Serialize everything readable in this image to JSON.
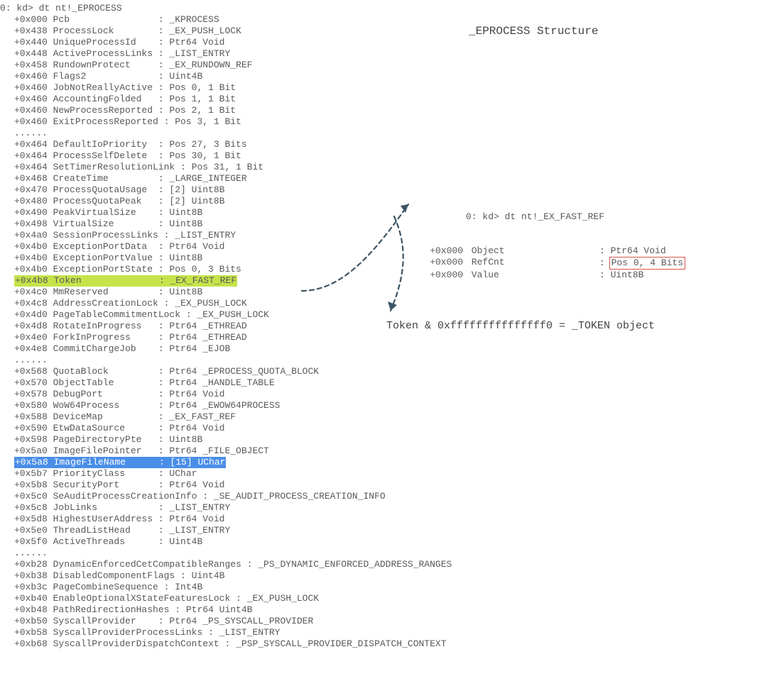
{
  "colors": {
    "highlight_green": "#c6e34a",
    "highlight_blue": "#4a8ee8",
    "box_red": "#d9544d"
  },
  "title": "_EPROCESS Structure",
  "main_prompt": "0: kd> dt nt!_EPROCESS",
  "lines": [
    {
      "offset": "+0x000",
      "name": "Pcb",
      "pad": "                ",
      "type": "_KPROCESS"
    },
    {
      "offset": "+0x438",
      "name": "ProcessLock",
      "pad": "        ",
      "type": "_EX_PUSH_LOCK"
    },
    {
      "offset": "+0x440",
      "name": "UniqueProcessId",
      "pad": "    ",
      "type": "Ptr64 Void"
    },
    {
      "offset": "+0x448",
      "name": "ActiveProcessLinks",
      "pad": " ",
      "type": "_LIST_ENTRY"
    },
    {
      "offset": "+0x458",
      "name": "RundownProtect",
      "pad": "     ",
      "type": "_EX_RUNDOWN_REF"
    },
    {
      "offset": "+0x460",
      "name": "Flags2",
      "pad": "             ",
      "type": "Uint4B"
    },
    {
      "offset": "+0x460",
      "name": "JobNotReallyActive",
      "pad": " ",
      "type": "Pos 0, 1 Bit"
    },
    {
      "offset": "+0x460",
      "name": "AccountingFolded",
      "pad": "   ",
      "type": "Pos 1, 1 Bit"
    },
    {
      "offset": "+0x460",
      "name": "NewProcessReported",
      "pad": " ",
      "type": "Pos 2, 1 Bit"
    },
    {
      "offset": "+0x460",
      "name": "ExitProcessReported",
      "pad": "",
      "type": "Pos 3, 1 Bit"
    },
    {
      "text": "......"
    },
    {
      "offset": "+0x464",
      "name": "DefaultIoPriority",
      "pad": "  ",
      "type": "Pos 27, 3 Bits"
    },
    {
      "offset": "+0x464",
      "name": "ProcessSelfDelete",
      "pad": "  ",
      "type": "Pos 30, 1 Bit"
    },
    {
      "offset": "+0x464",
      "name": "SetTimerResolutionLink",
      "pad": " ",
      "type": "Pos 31, 1 Bit",
      "nocolon": true
    },
    {
      "offset": "+0x468",
      "name": "CreateTime",
      "pad": "         ",
      "type": "_LARGE_INTEGER"
    },
    {
      "offset": "+0x470",
      "name": "ProcessQuotaUsage",
      "pad": "  ",
      "type": "[2] Uint8B"
    },
    {
      "offset": "+0x480",
      "name": "ProcessQuotaPeak",
      "pad": "   ",
      "type": "[2] Uint8B"
    },
    {
      "offset": "+0x490",
      "name": "PeakVirtualSize",
      "pad": "    ",
      "type": "Uint8B"
    },
    {
      "offset": "+0x498",
      "name": "VirtualSize",
      "pad": "        ",
      "type": "Uint8B"
    },
    {
      "offset": "+0x4a0",
      "name": "SessionProcessLinks",
      "pad": "",
      "type": "_LIST_ENTRY"
    },
    {
      "offset": "+0x4b0",
      "name": "ExceptionPortData",
      "pad": "  ",
      "type": "Ptr64 Void"
    },
    {
      "offset": "+0x4b0",
      "name": "ExceptionPortValue",
      "pad": " ",
      "type": "Uint8B"
    },
    {
      "offset": "+0x4b0",
      "name": "ExceptionPortState",
      "pad": " ",
      "type": "Pos 0, 3 Bits"
    },
    {
      "offset": "+0x4b8",
      "name": "Token",
      "pad": "              ",
      "type": "_EX_FAST_REF",
      "hl": "green"
    },
    {
      "offset": "+0x4c0",
      "name": "MmReserved",
      "pad": "         ",
      "type": "Uint8B"
    },
    {
      "offset": "+0x4c8",
      "name": "AddressCreationLock",
      "pad": "",
      "type": "_EX_PUSH_LOCK"
    },
    {
      "offset": "+0x4d0",
      "name": "PageTableCommitmentLock",
      "pad": " ",
      "type": "_EX_PUSH_LOCK",
      "nocolon": true
    },
    {
      "offset": "+0x4d8",
      "name": "RotateInProgress",
      "pad": "   ",
      "type": "Ptr64 _ETHREAD"
    },
    {
      "offset": "+0x4e0",
      "name": "ForkInProgress",
      "pad": "     ",
      "type": "Ptr64 _ETHREAD"
    },
    {
      "offset": "+0x4e8",
      "name": "CommitChargeJob",
      "pad": "    ",
      "type": "Ptr64 _EJOB"
    },
    {
      "text": "......"
    },
    {
      "offset": "+0x568",
      "name": "QuotaBlock",
      "pad": "         ",
      "type": "Ptr64 _EPROCESS_QUOTA_BLOCK"
    },
    {
      "offset": "+0x570",
      "name": "ObjectTable",
      "pad": "        ",
      "type": "Ptr64 _HANDLE_TABLE"
    },
    {
      "offset": "+0x578",
      "name": "DebugPort",
      "pad": "          ",
      "type": "Ptr64 Void"
    },
    {
      "offset": "+0x580",
      "name": "WoW64Process",
      "pad": "       ",
      "type": "Ptr64 _EWOW64PROCESS"
    },
    {
      "offset": "+0x588",
      "name": "DeviceMap",
      "pad": "          ",
      "type": "_EX_FAST_REF"
    },
    {
      "offset": "+0x590",
      "name": "EtwDataSource",
      "pad": "      ",
      "type": "Ptr64 Void"
    },
    {
      "offset": "+0x598",
      "name": "PageDirectoryPte",
      "pad": "   ",
      "type": "Uint8B"
    },
    {
      "offset": "+0x5a0",
      "name": "ImageFilePointer",
      "pad": "   ",
      "type": "Ptr64 _FILE_OBJECT"
    },
    {
      "offset": "+0x5a8",
      "name": "ImageFileName",
      "pad": "      ",
      "type": "[15] UChar",
      "hl": "blue"
    },
    {
      "offset": "+0x5b7",
      "name": "PriorityClass",
      "pad": "      ",
      "type": "UChar"
    },
    {
      "offset": "+0x5b8",
      "name": "SecurityPort",
      "pad": "       ",
      "type": "Ptr64 Void"
    },
    {
      "offset": "+0x5c0",
      "name": "SeAuditProcessCreationInfo",
      "pad": " ",
      "type": "_SE_AUDIT_PROCESS_CREATION_INFO",
      "nocolon": true
    },
    {
      "offset": "+0x5c8",
      "name": "JobLinks",
      "pad": "           ",
      "type": "_LIST_ENTRY"
    },
    {
      "offset": "+0x5d8",
      "name": "HighestUserAddress",
      "pad": " ",
      "type": "Ptr64 Void"
    },
    {
      "offset": "+0x5e0",
      "name": "ThreadListHead",
      "pad": "     ",
      "type": "_LIST_ENTRY"
    },
    {
      "offset": "+0x5f0",
      "name": "ActiveThreads",
      "pad": "      ",
      "type": "Uint4B"
    },
    {
      "text": "......"
    },
    {
      "offset": "+0xb28",
      "name": "DynamicEnforcedCetCompatibleRanges",
      "pad": " ",
      "type": "_PS_DYNAMIC_ENFORCED_ADDRESS_RANGES",
      "nocolon": true
    },
    {
      "offset": "+0xb38",
      "name": "DisabledComponentFlags",
      "pad": " ",
      "type": "Uint4B",
      "nocolon": true
    },
    {
      "offset": "+0xb3c",
      "name": "PageCombineSequence",
      "pad": " ",
      "type": "Int4B",
      "nocolon": true
    },
    {
      "offset": "+0xb40",
      "name": "EnableOptionalXStateFeaturesLock",
      "pad": " ",
      "type": "_EX_PUSH_LOCK",
      "nocolon": true
    },
    {
      "offset": "+0xb48",
      "name": "PathRedirectionHashes",
      "pad": " ",
      "type": "Ptr64 Uint4B",
      "nocolon": true
    },
    {
      "offset": "+0xb50",
      "name": "SyscallProvider",
      "pad": "    ",
      "type": "Ptr64 _PS_SYSCALL_PROVIDER"
    },
    {
      "offset": "+0xb58",
      "name": "SyscallProviderProcessLinks",
      "pad": " ",
      "type": "_LIST_ENTRY",
      "nocolon": true
    },
    {
      "offset": "+0xb68",
      "name": "SyscallProviderDispatchContext",
      "pad": " ",
      "type": "_PSP_SYSCALL_PROVIDER_DISPATCH_CONTEXT",
      "nocolon": true
    }
  ],
  "fastref_prompt": "0: kd> dt nt!_EX_FAST_REF",
  "fastref_lines": [
    {
      "offset": "+0x000",
      "name": "Object",
      "type": "Ptr64 Void"
    },
    {
      "offset": "+0x000",
      "name": "RefCnt",
      "type": "Pos 0, 4 Bits",
      "box": true
    },
    {
      "offset": "+0x000",
      "name": "Value",
      "type": "Uint8B"
    }
  ],
  "token_eq": "Token & 0xfffffffffffffff0 = _TOKEN object"
}
